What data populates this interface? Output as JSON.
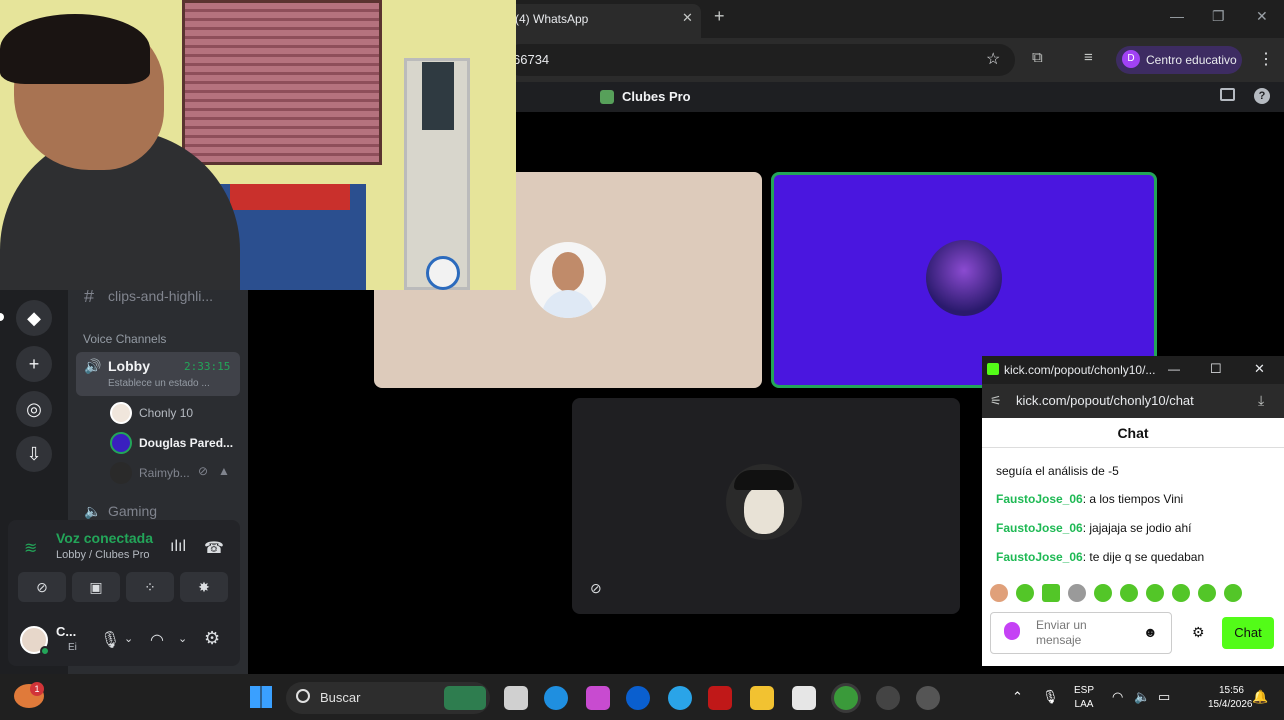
{
  "chrome": {
    "tab_title": "(4) WhatsApp",
    "tab_close": "✕",
    "new_tab": "+",
    "window_controls": [
      "—",
      "❐",
      "✕"
    ],
    "address": "66734",
    "profile_label": "Centro educativo",
    "profile_initial": "D"
  },
  "discord": {
    "server_title": "Clubes Pro",
    "help": "?",
    "channels": {
      "text_channel": "clips-and-highli...",
      "voice_header": "Voice Channels",
      "lobby": {
        "name": "Lobby",
        "time": "2:33:15",
        "status": "Establece un estado ..."
      },
      "members": [
        {
          "name": "Chonly 10",
          "color": "#b5bac1",
          "weight": "normal"
        },
        {
          "name": "Douglas Pared...",
          "color": "#f2f3f5",
          "weight": "bold"
        },
        {
          "name": "Raimyb...",
          "color": "#80848e",
          "weight": "normal"
        }
      ],
      "gaming": "Gaming"
    },
    "voice_panel": {
      "status": "Voz conectada",
      "sub": "Lobby / Clubes Pro"
    },
    "user": {
      "name": "C...",
      "sub": "Ei"
    }
  },
  "kick": {
    "window_title": "kick.com/popout/chonly10/...",
    "address": "kick.com/popout/chonly10/chat",
    "header": "Chat",
    "partial_message": "seguía el análisis de -5",
    "messages": [
      {
        "user": "FaustoJose_06",
        "text": ": a los tiempos Vini"
      },
      {
        "user": "FaustoJose_06",
        "text": ": jajajaja se jodio ahí"
      },
      {
        "user": "FaustoJose_06",
        "text": ": te dije q se quedaban"
      }
    ],
    "input_placeholder": "Enviar un mensaje",
    "send_label": "Chat"
  },
  "taskbar": {
    "search": "Buscar",
    "weather_badge": "1",
    "lang_top": "ESP",
    "lang_bottom": "LAA",
    "time": "15:56",
    "date": "15/4/2026"
  }
}
